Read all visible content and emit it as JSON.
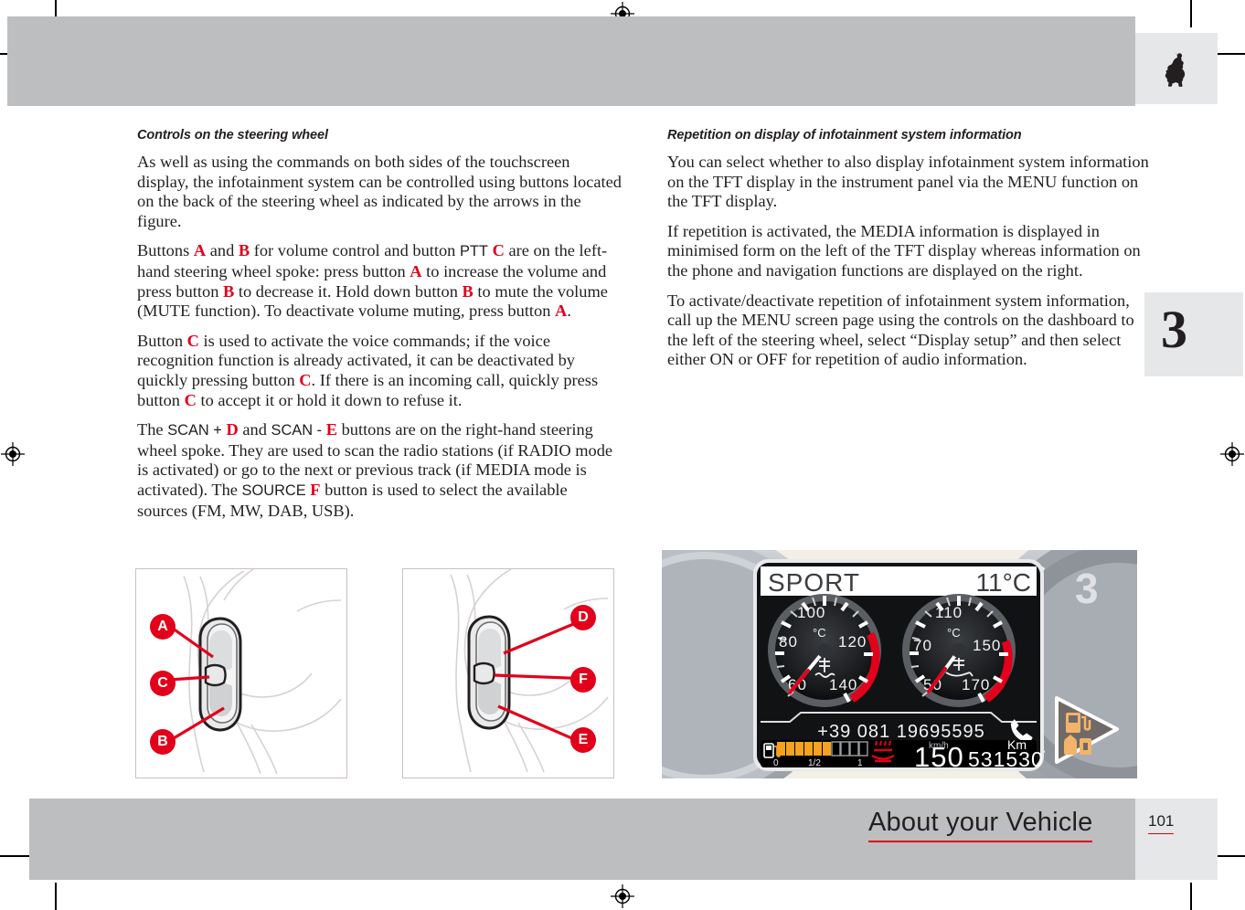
{
  "document": {
    "chapter_number": "3",
    "footer_title": "About your Vehicle",
    "page_number": "101",
    "brand_icon": "ferrari-prancing-horse-logo"
  },
  "left_column": {
    "heading": "Controls on the steering wheel",
    "paragraphs": [
      {
        "id": "p1",
        "text": "As well as using the commands on both sides of the touchscreen display, the infotainment system can be controlled using buttons located on the back of the steering wheel as indicated by the arrows in the figure."
      },
      {
        "id": "p2",
        "text": "Buttons A and B for volume control and button PTT C are on the left-hand steering wheel spoke: press button A to increase the volume and press button B to decrease it. Hold down button B to mute the volume (MUTE function). To deactivate volume muting, press button A."
      },
      {
        "id": "p3",
        "text": "Button C is used to activate the voice commands; if the voice recognition function is already activated, it can be deactivated by quickly pressing button C. If there is an incoming call, quickly press button C to accept it or hold it down to refuse it."
      },
      {
        "id": "p4",
        "text": "The SCAN + D and SCAN - E buttons are on the right-hand steering wheel spoke. They are used to scan the radio stations (if RADIO mode is activated) or go to the next or previous track (if MEDIA mode is activated). The SOURCE F button is used to select the available sources (FM, MW, DAB, USB)."
      }
    ]
  },
  "right_column": {
    "heading": "Repetition on display of infotainment system information",
    "paragraphs": [
      {
        "id": "r1",
        "text": "You can select whether to also display infotainment system information on the TFT display in the instrument panel via the MENU function on the TFT display."
      },
      {
        "id": "r2",
        "text": "If repetition is activated, the MEDIA information is displayed in minimised form on the left of the TFT display whereas information on the phone and navigation functions are displayed on the right."
      },
      {
        "id": "r3",
        "text": "To activate/deactivate repetition of infotainment system information, call up the MENU screen page using the controls on the dashboard to the left of the steering wheel, select “Display setup” and then select either ON or OFF for repetition of audio information."
      }
    ]
  },
  "figures": {
    "left_figure": {
      "caption_labels": [
        "A",
        "C",
        "B"
      ],
      "description": "left-hand steering wheel spoke rear with buttons"
    },
    "right_figure": {
      "caption_labels": [
        "D",
        "F",
        "E"
      ],
      "description": "right-hand steering wheel spoke rear with buttons"
    },
    "cluster": {
      "mode_label": "SPORT",
      "outside_temperature": "11°C",
      "gauge_left": {
        "unit": "°C",
        "icon": "coolant-temperature-icon",
        "ticks": [
          "60",
          "80",
          "100",
          "120",
          "140"
        ],
        "redline_from": "125"
      },
      "gauge_right": {
        "unit": "°C",
        "icon": "oil-temperature-icon",
        "ticks": [
          "50",
          "70",
          "110",
          "150",
          "170"
        ],
        "redline_from": "155"
      },
      "phone_number": "+39 081 19695595",
      "phone_icon": "handset-icon",
      "fuel": {
        "icon": "fuel-pump-icon",
        "labels": [
          "0",
          "1/2",
          "1"
        ],
        "segments_total": 10,
        "segments_filled": 6
      },
      "coolant_warning_icon": "engine-coolant-warning-icon",
      "speed_value": "150",
      "speed_unit": "km/h",
      "odometer_value": "531530",
      "odometer_unit": "Km",
      "side_tell_tales": [
        "low-fuel-icon",
        "fuel-cap-open-icon"
      ],
      "tacho_partial_label": "3"
    }
  },
  "colors": {
    "accent_red": "#e2001a",
    "band_gray": "#bcbec0",
    "box_gray": "#e6e7e8",
    "text": "#231f20",
    "fuel_orange": "#f5a21e"
  }
}
